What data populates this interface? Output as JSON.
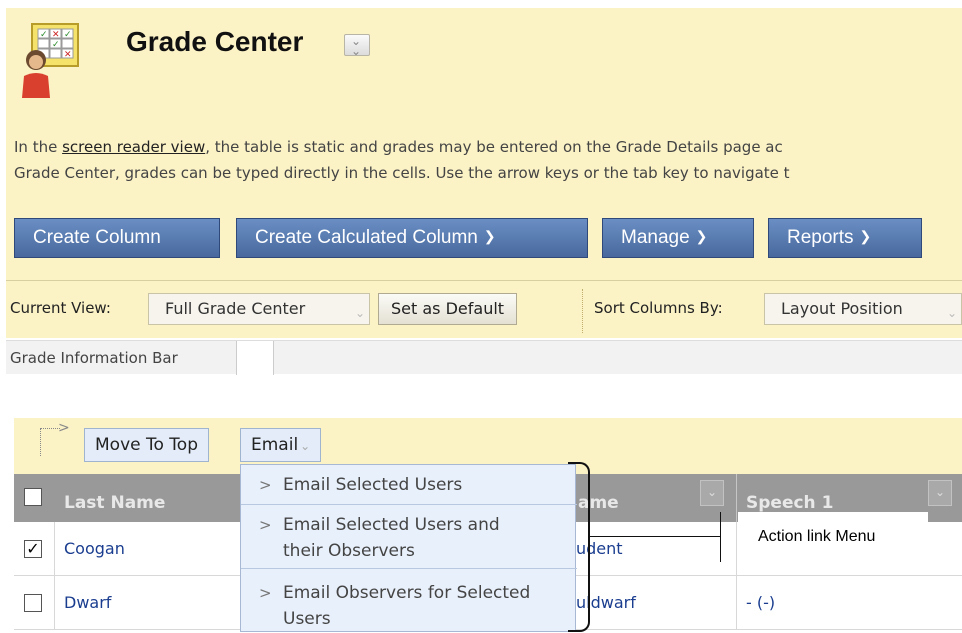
{
  "header": {
    "title": "Grade Center",
    "intro_link": "screen reader view",
    "intro_pre": "In the ",
    "intro_post": ", the table is static and grades may be entered on the Grade Details page ac",
    "intro_line2": "Grade Center, grades can be typed directly in the cells. Use the arrow keys or the tab key to navigate t"
  },
  "action_bar": {
    "create_column": "Create Column",
    "create_calculated": "Create Calculated Column",
    "manage": "Manage",
    "reports": "Reports"
  },
  "view_bar": {
    "current_view_label": "Current View:",
    "current_view_value": "Full Grade Center",
    "set_default": "Set as Default",
    "sort_label": "Sort Columns By:",
    "sort_value": "Layout Position"
  },
  "info_bar": {
    "label": "Grade Information Bar"
  },
  "table_toolbar": {
    "move_to_top": "Move To Top",
    "email": "Email"
  },
  "email_menu": {
    "items": [
      {
        "line1": "Email Selected Users",
        "line2": ""
      },
      {
        "line1": "Email Selected Users and",
        "line2": "their Observers"
      },
      {
        "line1": "Email Observers for Selected",
        "line2": "Users"
      }
    ]
  },
  "grid": {
    "columns": [
      "Last Name",
      "ame",
      "Speech 1"
    ],
    "rows": [
      {
        "checked": true,
        "last_name": "Coogan",
        "username": "udent",
        "speech1": ""
      },
      {
        "checked": false,
        "last_name": "Dwarf",
        "username": "uldwarf",
        "speech1": "- (-)"
      }
    ]
  },
  "annotation": {
    "label": "Action link Menu"
  },
  "colors": {
    "panel": "#fbf2c6",
    "button": "#5a7db5",
    "header": "#999999",
    "menu": "#e8f0fb"
  }
}
